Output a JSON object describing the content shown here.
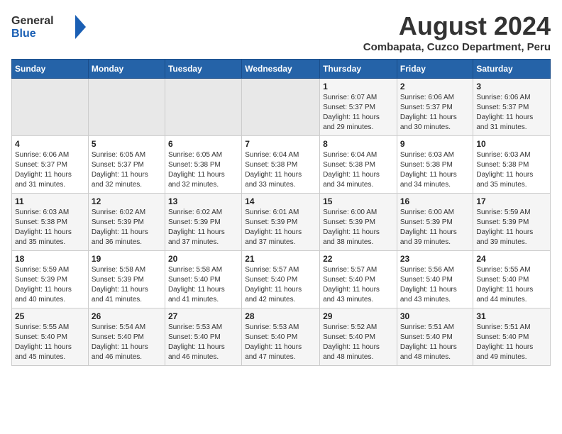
{
  "header": {
    "logo_general": "General",
    "logo_blue": "Blue",
    "title": "August 2024",
    "subtitle": "Combapata, Cuzco Department, Peru"
  },
  "weekdays": [
    "Sunday",
    "Monday",
    "Tuesday",
    "Wednesday",
    "Thursday",
    "Friday",
    "Saturday"
  ],
  "weeks": [
    [
      {
        "day": "",
        "detail": ""
      },
      {
        "day": "",
        "detail": ""
      },
      {
        "day": "",
        "detail": ""
      },
      {
        "day": "",
        "detail": ""
      },
      {
        "day": "1",
        "detail": "Sunrise: 6:07 AM\nSunset: 5:37 PM\nDaylight: 11 hours\nand 29 minutes."
      },
      {
        "day": "2",
        "detail": "Sunrise: 6:06 AM\nSunset: 5:37 PM\nDaylight: 11 hours\nand 30 minutes."
      },
      {
        "day": "3",
        "detail": "Sunrise: 6:06 AM\nSunset: 5:37 PM\nDaylight: 11 hours\nand 31 minutes."
      }
    ],
    [
      {
        "day": "4",
        "detail": "Sunrise: 6:06 AM\nSunset: 5:37 PM\nDaylight: 11 hours\nand 31 minutes."
      },
      {
        "day": "5",
        "detail": "Sunrise: 6:05 AM\nSunset: 5:37 PM\nDaylight: 11 hours\nand 32 minutes."
      },
      {
        "day": "6",
        "detail": "Sunrise: 6:05 AM\nSunset: 5:38 PM\nDaylight: 11 hours\nand 32 minutes."
      },
      {
        "day": "7",
        "detail": "Sunrise: 6:04 AM\nSunset: 5:38 PM\nDaylight: 11 hours\nand 33 minutes."
      },
      {
        "day": "8",
        "detail": "Sunrise: 6:04 AM\nSunset: 5:38 PM\nDaylight: 11 hours\nand 34 minutes."
      },
      {
        "day": "9",
        "detail": "Sunrise: 6:03 AM\nSunset: 5:38 PM\nDaylight: 11 hours\nand 34 minutes."
      },
      {
        "day": "10",
        "detail": "Sunrise: 6:03 AM\nSunset: 5:38 PM\nDaylight: 11 hours\nand 35 minutes."
      }
    ],
    [
      {
        "day": "11",
        "detail": "Sunrise: 6:03 AM\nSunset: 5:38 PM\nDaylight: 11 hours\nand 35 minutes."
      },
      {
        "day": "12",
        "detail": "Sunrise: 6:02 AM\nSunset: 5:39 PM\nDaylight: 11 hours\nand 36 minutes."
      },
      {
        "day": "13",
        "detail": "Sunrise: 6:02 AM\nSunset: 5:39 PM\nDaylight: 11 hours\nand 37 minutes."
      },
      {
        "day": "14",
        "detail": "Sunrise: 6:01 AM\nSunset: 5:39 PM\nDaylight: 11 hours\nand 37 minutes."
      },
      {
        "day": "15",
        "detail": "Sunrise: 6:00 AM\nSunset: 5:39 PM\nDaylight: 11 hours\nand 38 minutes."
      },
      {
        "day": "16",
        "detail": "Sunrise: 6:00 AM\nSunset: 5:39 PM\nDaylight: 11 hours\nand 39 minutes."
      },
      {
        "day": "17",
        "detail": "Sunrise: 5:59 AM\nSunset: 5:39 PM\nDaylight: 11 hours\nand 39 minutes."
      }
    ],
    [
      {
        "day": "18",
        "detail": "Sunrise: 5:59 AM\nSunset: 5:39 PM\nDaylight: 11 hours\nand 40 minutes."
      },
      {
        "day": "19",
        "detail": "Sunrise: 5:58 AM\nSunset: 5:39 PM\nDaylight: 11 hours\nand 41 minutes."
      },
      {
        "day": "20",
        "detail": "Sunrise: 5:58 AM\nSunset: 5:40 PM\nDaylight: 11 hours\nand 41 minutes."
      },
      {
        "day": "21",
        "detail": "Sunrise: 5:57 AM\nSunset: 5:40 PM\nDaylight: 11 hours\nand 42 minutes."
      },
      {
        "day": "22",
        "detail": "Sunrise: 5:57 AM\nSunset: 5:40 PM\nDaylight: 11 hours\nand 43 minutes."
      },
      {
        "day": "23",
        "detail": "Sunrise: 5:56 AM\nSunset: 5:40 PM\nDaylight: 11 hours\nand 43 minutes."
      },
      {
        "day": "24",
        "detail": "Sunrise: 5:55 AM\nSunset: 5:40 PM\nDaylight: 11 hours\nand 44 minutes."
      }
    ],
    [
      {
        "day": "25",
        "detail": "Sunrise: 5:55 AM\nSunset: 5:40 PM\nDaylight: 11 hours\nand 45 minutes."
      },
      {
        "day": "26",
        "detail": "Sunrise: 5:54 AM\nSunset: 5:40 PM\nDaylight: 11 hours\nand 46 minutes."
      },
      {
        "day": "27",
        "detail": "Sunrise: 5:53 AM\nSunset: 5:40 PM\nDaylight: 11 hours\nand 46 minutes."
      },
      {
        "day": "28",
        "detail": "Sunrise: 5:53 AM\nSunset: 5:40 PM\nDaylight: 11 hours\nand 47 minutes."
      },
      {
        "day": "29",
        "detail": "Sunrise: 5:52 AM\nSunset: 5:40 PM\nDaylight: 11 hours\nand 48 minutes."
      },
      {
        "day": "30",
        "detail": "Sunrise: 5:51 AM\nSunset: 5:40 PM\nDaylight: 11 hours\nand 48 minutes."
      },
      {
        "day": "31",
        "detail": "Sunrise: 5:51 AM\nSunset: 5:40 PM\nDaylight: 11 hours\nand 49 minutes."
      }
    ]
  ]
}
